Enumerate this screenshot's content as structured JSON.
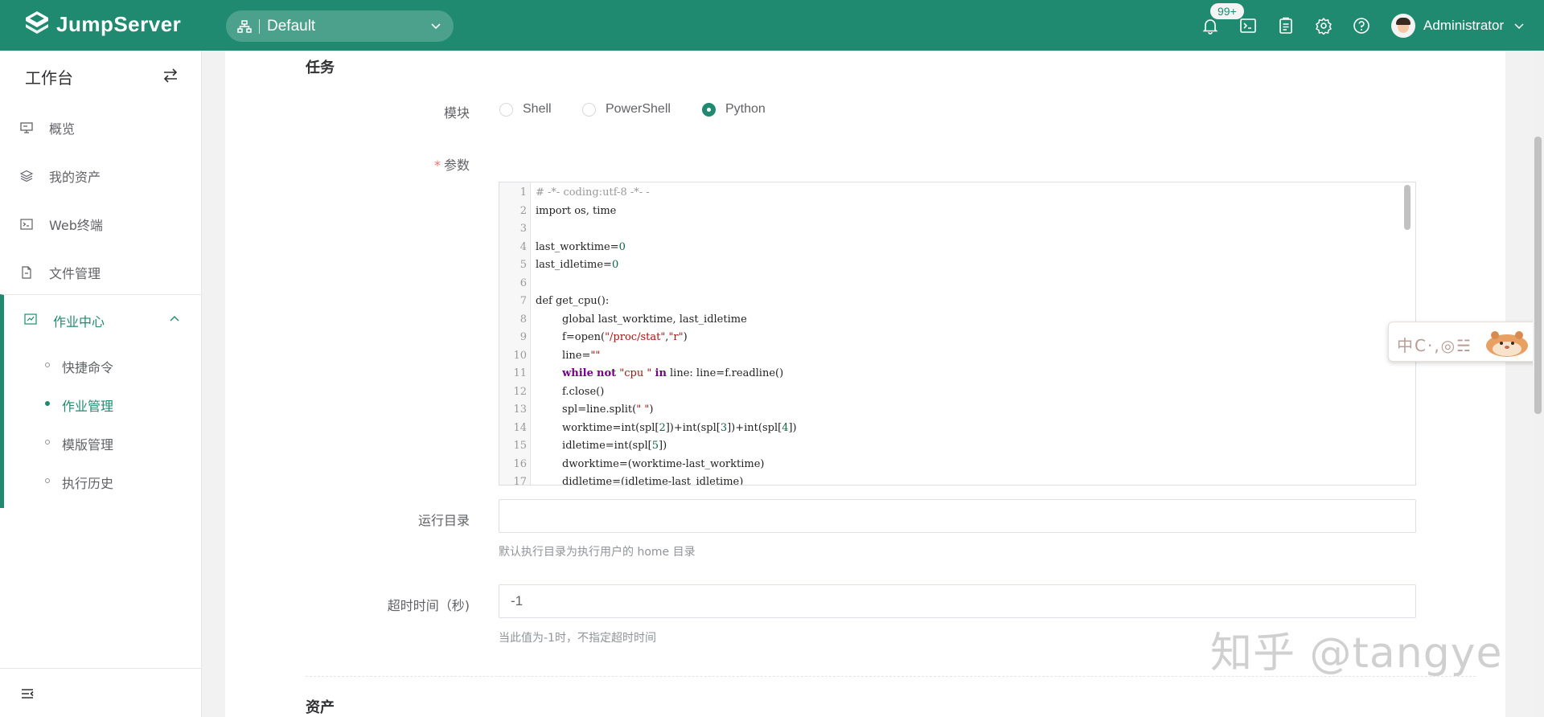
{
  "app": {
    "name": "JumpServer"
  },
  "topbar": {
    "org_label": "Default",
    "notification_badge": "99+",
    "user_name": "Administrator",
    "icons": [
      "bell-icon",
      "terminal-icon",
      "clipboard-icon",
      "gear-icon",
      "help-icon"
    ]
  },
  "sidebar": {
    "title": "工作台",
    "items": [
      {
        "label": "概览",
        "icon": "monitor-icon"
      },
      {
        "label": "我的资产",
        "icon": "layers-icon"
      },
      {
        "label": "Web终端",
        "icon": "terminal-icon"
      },
      {
        "label": "文件管理",
        "icon": "file-icon"
      }
    ],
    "group": {
      "label": "作业中心",
      "icon": "job-icon",
      "children": [
        {
          "label": "快捷命令",
          "active": false
        },
        {
          "label": "作业管理",
          "active": true
        },
        {
          "label": "模版管理",
          "active": false
        },
        {
          "label": "执行历史",
          "active": false
        }
      ]
    }
  },
  "form": {
    "section_task": "任务",
    "module_label": "模块",
    "module_options": [
      "Shell",
      "PowerShell",
      "Python"
    ],
    "module_selected": "Python",
    "params_required_mark": "*",
    "params_label": "参数",
    "code_lines": [
      "# -*- coding:utf-8 -*- -",
      "import os, time",
      "",
      "last_worktime=0",
      "last_idletime=0",
      "",
      "def get_cpu():",
      "        global last_worktime, last_idletime",
      "        f=open(\"/proc/stat\",\"r\")",
      "        line=\"\"",
      "        while not \"cpu \" in line: line=f.readline()",
      "        f.close()",
      "        spl=line.split(\" \")",
      "        worktime=int(spl[2])+int(spl[3])+int(spl[4])",
      "        idletime=int(spl[5])",
      "        dworktime=(worktime-last_worktime)",
      "        didletime=(idletime-last_idletime)"
    ],
    "run_dir_label": "运行目录",
    "run_dir_value": "",
    "run_dir_hint": "默认执行目录为执行用户的 home 目录",
    "timeout_label": "超时时间（秒)",
    "timeout_value": "-1",
    "timeout_hint": "当此值为-1时，不指定超时时间",
    "section_assets": "资产"
  },
  "overlay": {
    "widget_text": "中C·,◎☵",
    "watermark": "知乎 @tangye"
  },
  "colors": {
    "brand": "#1f8a6f",
    "required": "#f56c6c",
    "code_string": "#a11",
    "code_keyword": "#708",
    "code_number": "#164"
  }
}
